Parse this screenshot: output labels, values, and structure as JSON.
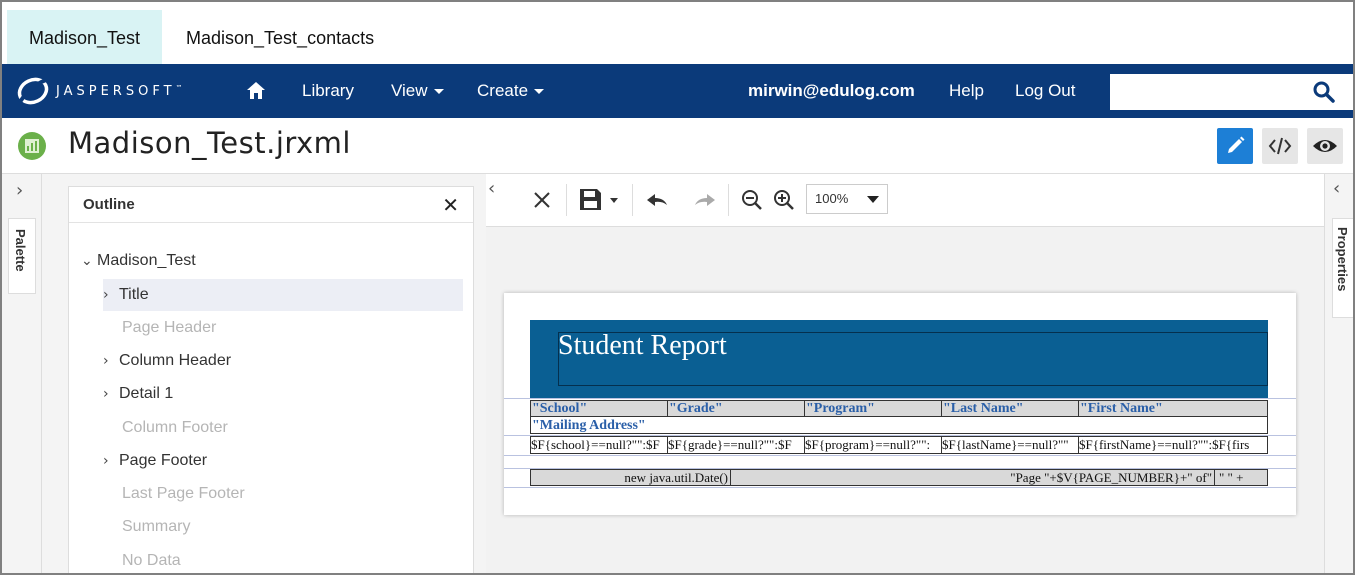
{
  "tabs": [
    {
      "label": "Madison_Test"
    },
    {
      "label": "Madison_Test_contacts"
    }
  ],
  "navbar": {
    "brand": "JASPERSOFT",
    "brand_tm": "™",
    "library": "Library",
    "view": "View",
    "create": "Create",
    "user": "mirwin@edulog.com",
    "help": "Help",
    "logout": "Log Out",
    "search_value": ""
  },
  "document": {
    "title": "Madison_Test.jrxml"
  },
  "palette": {
    "label": "Palette"
  },
  "properties": {
    "label": "Properties"
  },
  "outline": {
    "title": "Outline",
    "root": "Madison_Test",
    "items": [
      {
        "label": "Title"
      },
      {
        "label": "Page Header"
      },
      {
        "label": "Column Header"
      },
      {
        "label": "Detail 1"
      },
      {
        "label": "Column Footer"
      },
      {
        "label": "Page Footer"
      },
      {
        "label": "Last Page Footer"
      },
      {
        "label": "Summary"
      },
      {
        "label": "No Data"
      }
    ]
  },
  "toolbar": {
    "zoom": "100%"
  },
  "report": {
    "title": "Student Report",
    "columns": [
      "\"School\"",
      "\"Grade\"",
      "\"Program\"",
      "\"Last Name\"",
      "\"First Name\""
    ],
    "mailing": "\"Mailing Address\"",
    "detail": [
      "$F{school}==null?\"\":$F",
      "$F{grade}==null?\"\":$F",
      "$F{program}==null?\"\":",
      "$F{lastName}==null?\"\"",
      "$F{firstName}==null?\"\":$F{firs"
    ],
    "footer_date": "new java.util.Date()",
    "footer_page": "\"Page \"+$V{PAGE_NUMBER}+\" of\"",
    "footer_total": "\" \" +"
  },
  "colors": {
    "navbar": "#0b3a7a",
    "active_tab": "#d9f3f4",
    "report_title_band": "#0a5f93",
    "edit_button": "#1d7fd6"
  }
}
